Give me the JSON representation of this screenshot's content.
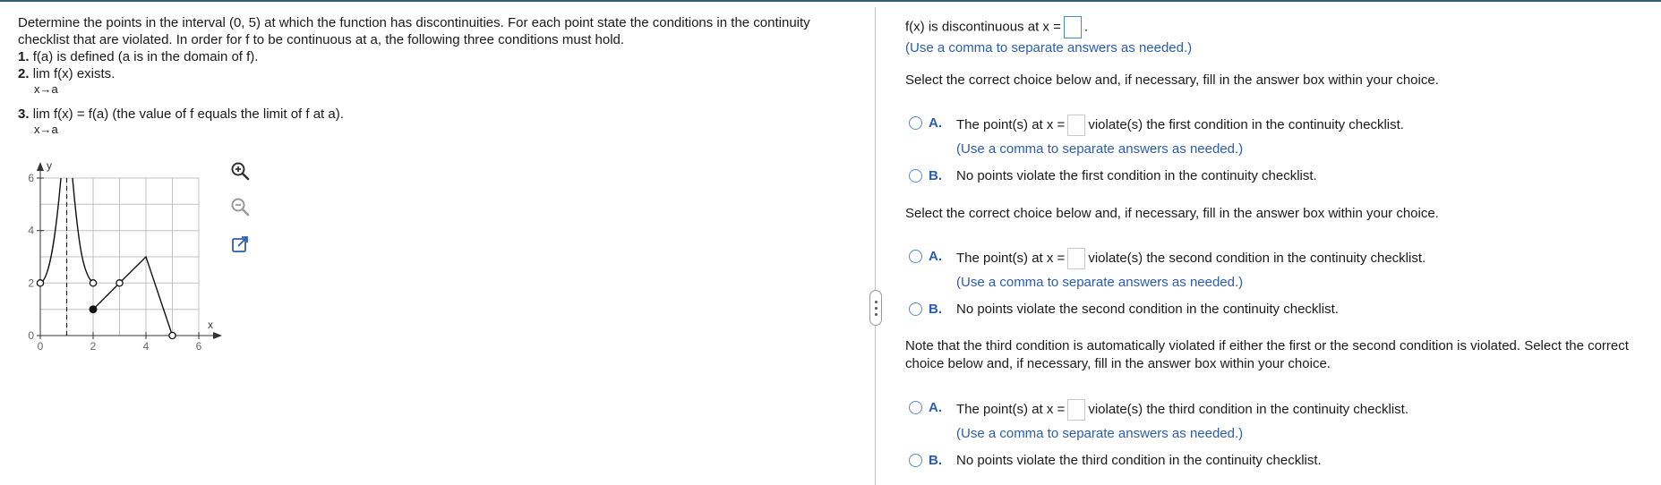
{
  "problem": {
    "intro": "Determine the points in the interval (0, 5) at which the function has discontinuities. For each point state the conditions in the continuity checklist that are violated. In order for f to be continuous at a, the following three conditions must hold.",
    "c1_num": "1.",
    "c1_text": "f(a) is defined (a is in the domain of f).",
    "c2_num": "2.",
    "c2_text": "lim  f(x) exists.",
    "c2_sub": "x→a",
    "c3_num": "3.",
    "c3_text": "lim  f(x) = f(a) (the value of f equals the limit of f at a).",
    "c3_sub": "x→a"
  },
  "graph": {
    "ylabel": "y",
    "xlabel": "x",
    "xticks": [
      "0",
      "2",
      "4",
      "6"
    ],
    "yticks": [
      "0",
      "2",
      "4",
      "6"
    ],
    "tools": [
      "zoom-in-icon",
      "zoom-out-icon",
      "popout-icon"
    ]
  },
  "answers": {
    "q1_prefix": "f(x) is discontinuous at x =",
    "q1_suffix": ".",
    "comma_hint": "(Use a comma to separate answers as needed.)",
    "select_prompt": "Select the correct choice below and, if necessary, fill in the answer box within your choice.",
    "note_prompt": "Note that the third condition is automatically violated if either the first or the second condition is violated. Select the correct choice below and, if necessary, fill in the answer box within your choice.",
    "letter_a": "A.",
    "letter_b": "B.",
    "point_prefix": "The point(s) at x =",
    "first_a_suffix": "violate(s) the first condition in the continuity checklist.",
    "first_b": "No points violate the first condition in the continuity checklist.",
    "second_a_suffix": "violate(s) the second condition in the continuity checklist.",
    "second_b": "No points violate the second condition in the continuity checklist.",
    "third_a_suffix": "violate(s) the third condition in the continuity checklist.",
    "third_b": "No points violate the third condition in the continuity checklist."
  },
  "colors": {
    "accent": "#2a5db0",
    "radio": "#5a8ccc",
    "topbar": "#2d5f6e",
    "grid": "#c0c0c0"
  }
}
